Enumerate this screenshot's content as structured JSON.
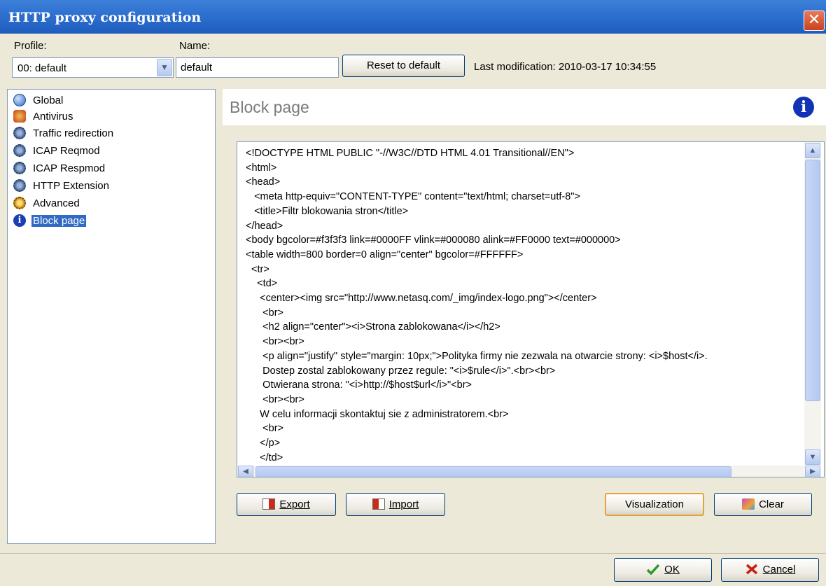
{
  "window": {
    "title": "HTTP proxy configuration",
    "close_glyph": "✕"
  },
  "profile": {
    "label": "Profile:",
    "selected": "00: default"
  },
  "name": {
    "label": "Name:",
    "value": "default"
  },
  "reset_button": "Reset to default",
  "last_modification": "Last modification: 2010-03-17 10:34:55",
  "tree": {
    "items": [
      {
        "label": "Global",
        "icon": "globe-icon"
      },
      {
        "label": "Antivirus",
        "icon": "antivirus-icon"
      },
      {
        "label": "Traffic redirection",
        "icon": "gear-icon"
      },
      {
        "label": "ICAP Reqmod",
        "icon": "gear-icon"
      },
      {
        "label": "ICAP Respmod",
        "icon": "gear-icon"
      },
      {
        "label": "HTTP Extension",
        "icon": "gear-icon"
      },
      {
        "label": "Advanced",
        "icon": "gear-icon"
      },
      {
        "label": "Block page",
        "icon": "info-icon",
        "selected": true
      }
    ]
  },
  "panel": {
    "title": "Block page"
  },
  "editor": {
    "lines": [
      "<!DOCTYPE HTML PUBLIC \"-//W3C//DTD HTML 4.01 Transitional//EN\">",
      "<html>",
      "<head>",
      "   <meta http-equiv=\"CONTENT-TYPE\" content=\"text/html; charset=utf-8\">",
      "   <title>Filtr blokowania stron</title>",
      "</head>",
      "<body bgcolor=#f3f3f3 link=#0000FF vlink=#000080 alink=#FF0000 text=#000000>",
      "<table width=800 border=0 align=\"center\" bgcolor=#FFFFFF>",
      "  <tr>",
      "    <td>",
      "     <center><img src=\"http://www.netasq.com/_img/index-logo.png\"></center>",
      "      <br>",
      "      <h2 align=\"center\"><i>Strona zablokowana</i></h2>",
      "      <br><br>",
      "      <p align=\"justify\" style=\"margin: 10px;\">Polityka firmy nie zezwala na otwarcie strony: <i>$host</i>.",
      "      Dostep zostal zablokowany przez regule: \"<i>$rule</i>\".<br><br>",
      "      Otwierana strona: \"<i>http://$host$url</i>\"<br>",
      "      <br><br>",
      "     W celu informacji skontaktuj sie z administratorem.<br>",
      "      <br>",
      "     </p>",
      "     </td>"
    ]
  },
  "buttons": {
    "export": "Export",
    "import": "Import",
    "visualization": "Visualization",
    "clear": "Clear",
    "ok": "OK",
    "cancel": "Cancel"
  }
}
